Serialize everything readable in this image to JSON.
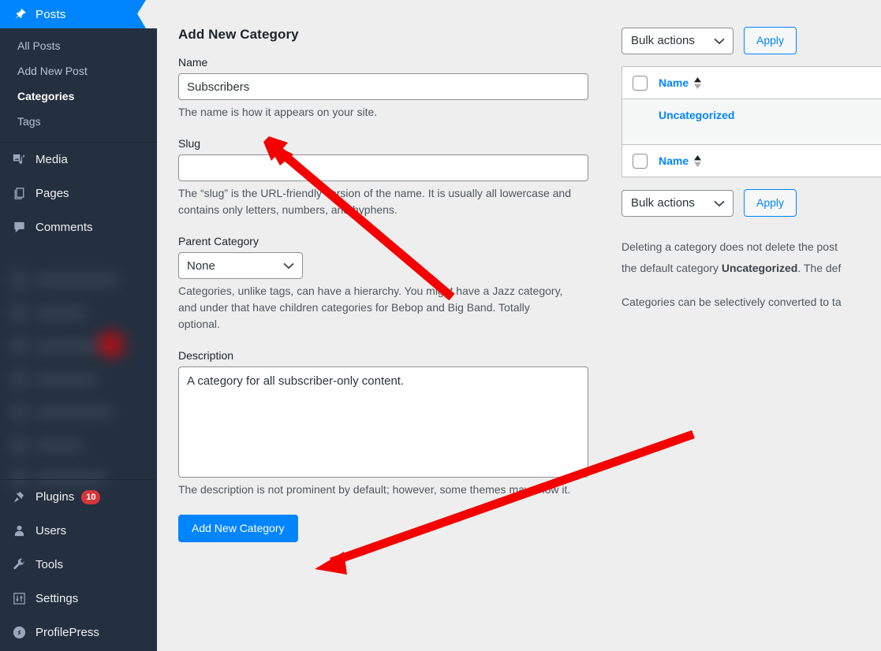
{
  "sidebar": {
    "menu_head": {
      "label": "Posts",
      "icon": "pin-icon"
    },
    "submenu": [
      {
        "label": "All Posts",
        "current": false
      },
      {
        "label": "Add New Post",
        "current": false
      },
      {
        "label": "Categories",
        "current": true
      },
      {
        "label": "Tags",
        "current": false
      }
    ],
    "items": [
      {
        "label": "Media",
        "icon": "media-icon",
        "badge": ""
      },
      {
        "label": "Pages",
        "icon": "pages-icon",
        "badge": ""
      },
      {
        "label": "Comments",
        "icon": "comments-icon",
        "badge": ""
      }
    ],
    "items_bottom": [
      {
        "label": "Plugins",
        "icon": "plug-icon",
        "badge": "10"
      },
      {
        "label": "Users",
        "icon": "user-icon",
        "badge": ""
      },
      {
        "label": "Tools",
        "icon": "wrench-icon",
        "badge": ""
      },
      {
        "label": "Settings",
        "icon": "sliders-icon",
        "badge": ""
      },
      {
        "label": "ProfilePress",
        "icon": "profilepress-icon",
        "badge": ""
      }
    ]
  },
  "form": {
    "title": "Add New Category",
    "name": {
      "label": "Name",
      "value": "Subscribers",
      "placeholder": "",
      "help": "The name is how it appears on your site."
    },
    "slug": {
      "label": "Slug",
      "value": "",
      "placeholder": "",
      "help": "The “slug” is the URL-friendly version of the name. It is usually all lowercase and contains only letters, numbers, and hyphens."
    },
    "parent": {
      "label": "Parent Category",
      "value": "None",
      "options": [
        "None"
      ],
      "help": "Categories, unlike tags, can have a hierarchy. You might have a Jazz category, and under that have children categories for Bebop and Big Band. Totally optional."
    },
    "description": {
      "label": "Description",
      "value": "A category for all subscriber-only content.",
      "placeholder": "",
      "help": "The description is not prominent by default; however, some themes may show it."
    },
    "submit_label": "Add New Category"
  },
  "list": {
    "bulk_actions_top": {
      "value": "Bulk actions",
      "options": [
        "Bulk actions"
      ]
    },
    "apply_top": "Apply",
    "bulk_actions_bottom": {
      "value": "Bulk actions",
      "options": [
        "Bulk actions"
      ]
    },
    "apply_bottom": "Apply",
    "columns": [
      "Name"
    ],
    "rows": [
      {
        "name": "Uncategorized"
      }
    ],
    "notes": [
      "Deleting a category does not delete the post",
      "the default category Uncategorized. The def",
      "Categories can be selectively converted to ta"
    ],
    "note_bold_word": "Uncategorized"
  },
  "colors": {
    "accent_blue": "#0085ff",
    "sidebar_bg": "#24303f",
    "badge_red": "#d63638",
    "annotation_red": "#f40000",
    "content_bg": "#eeeeee"
  }
}
